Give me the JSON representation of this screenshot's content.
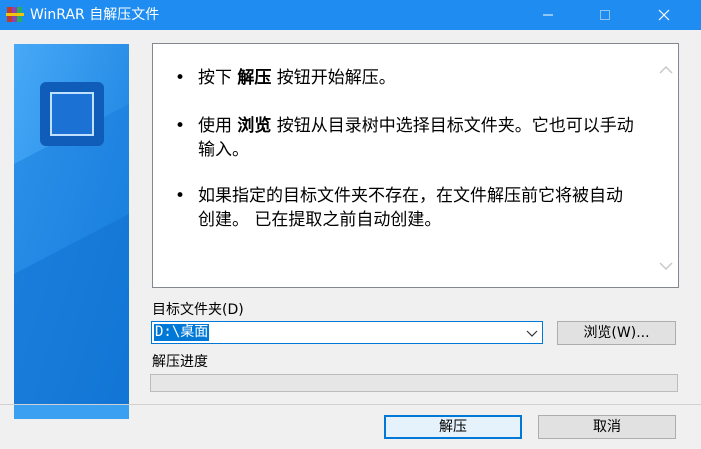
{
  "window": {
    "title": "WinRAR 自解压文件",
    "title_bar_color": "#1e8cf0"
  },
  "icons": {
    "app": "winrar-books-icon",
    "minimize": "minimize-icon",
    "maximize": "maximize-icon",
    "close": "close-icon",
    "logo": "winrar-square-logo-icon",
    "scroll_up": "chevron-up-icon",
    "scroll_down": "chevron-down-icon",
    "dropdown": "chevron-down-icon"
  },
  "info": {
    "bullet": "•",
    "item1": {
      "before": "按下 ",
      "bold": "解压",
      "after": " 按钮开始解压。"
    },
    "item2": {
      "before": "使用 ",
      "bold": "浏览",
      "after": " 按钮从目录树中选择目标文件夹。它也可以手动输入。"
    },
    "item3": {
      "text": "如果指定的目标文件夹不存在，在文件解压前它将被自动创建。 已在提取之前自动创建。"
    }
  },
  "destination": {
    "label": "目标文件夹(D)",
    "value": "D:\\桌面",
    "browse_label": "浏览(W)..."
  },
  "progress": {
    "label": "解压进度",
    "value": 0
  },
  "buttons": {
    "extract": "解压",
    "cancel": "取消"
  },
  "colors": {
    "accent": "#0078d7",
    "side_panel": "#1484e6"
  }
}
